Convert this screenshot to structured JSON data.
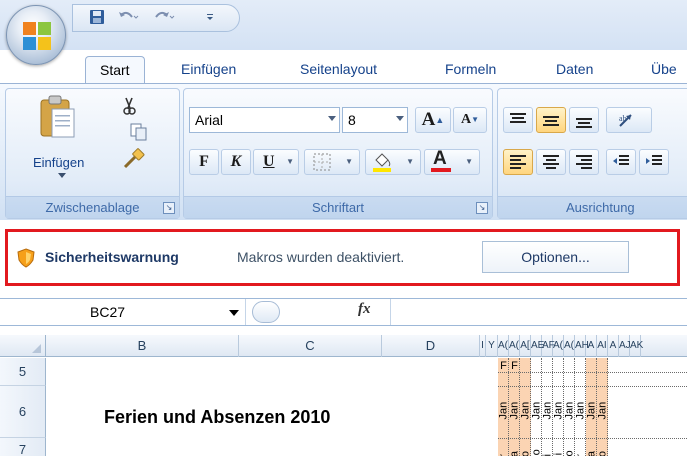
{
  "quick_access": {
    "save_icon": "save-icon",
    "undo_icon": "undo-icon",
    "redo_icon": "redo-icon",
    "customize_icon": "customize-qat-icon"
  },
  "tabs": [
    {
      "label": "Start",
      "active": true
    },
    {
      "label": "Einfügen",
      "active": false
    },
    {
      "label": "Seitenlayout",
      "active": false
    },
    {
      "label": "Formeln",
      "active": false
    },
    {
      "label": "Daten",
      "active": false
    },
    {
      "label": "Übe",
      "active": false
    }
  ],
  "ribbon": {
    "clipboard": {
      "paste_label": "Einfügen",
      "group_label": "Zwischenablage"
    },
    "font": {
      "font_name": "Arial",
      "font_size": "8",
      "bold": "F",
      "italic": "K",
      "underline": "U",
      "grow": "A",
      "shrink": "A",
      "font_color": "#e2191f",
      "fill_color": "#ffe600",
      "group_label": "Schriftart"
    },
    "alignment": {
      "group_label": "Ausrichtung"
    }
  },
  "security_bar": {
    "title": "Sicherheitswarnung",
    "message": "Makros wurden deaktiviert.",
    "options_label": "Optionen...",
    "highlight_color": "#e2191f"
  },
  "formula_bar": {
    "name_box": "BC27",
    "fx_label": "fx",
    "formula": ""
  },
  "sheet": {
    "columns": [
      "B",
      "C",
      "D",
      "I",
      "Y",
      "A(",
      "A(",
      "A[",
      "AE",
      "AF",
      "A(",
      "A(",
      "AH",
      "A",
      "AI",
      "A",
      "AJ",
      "AK"
    ],
    "rows": [
      "5",
      "6",
      "7"
    ],
    "title": "Ferien und Absenzen 2010",
    "day_columns": [
      {
        "r5": "F",
        "month": "Jan",
        "day": "Fr",
        "orange": true
      },
      {
        "r5": "F",
        "month": "Jan",
        "day": "Sa",
        "orange": true
      },
      {
        "r5": "",
        "month": "Jan",
        "day": "So",
        "orange": true
      },
      {
        "r5": "",
        "month": "Jan",
        "day": "Mo",
        "orange": false
      },
      {
        "r5": "",
        "month": "Jan",
        "day": "Di",
        "orange": false
      },
      {
        "r5": "",
        "month": "Jan",
        "day": "Mi",
        "orange": false
      },
      {
        "r5": "",
        "month": "Jan",
        "day": "Do",
        "orange": false
      },
      {
        "r5": "",
        "month": "Jan",
        "day": "Fr",
        "orange": false
      },
      {
        "r5": "",
        "month": "Jan",
        "day": "Sa",
        "orange": true
      },
      {
        "r5": "",
        "month": "Jan",
        "day": "So",
        "orange": true
      }
    ]
  }
}
